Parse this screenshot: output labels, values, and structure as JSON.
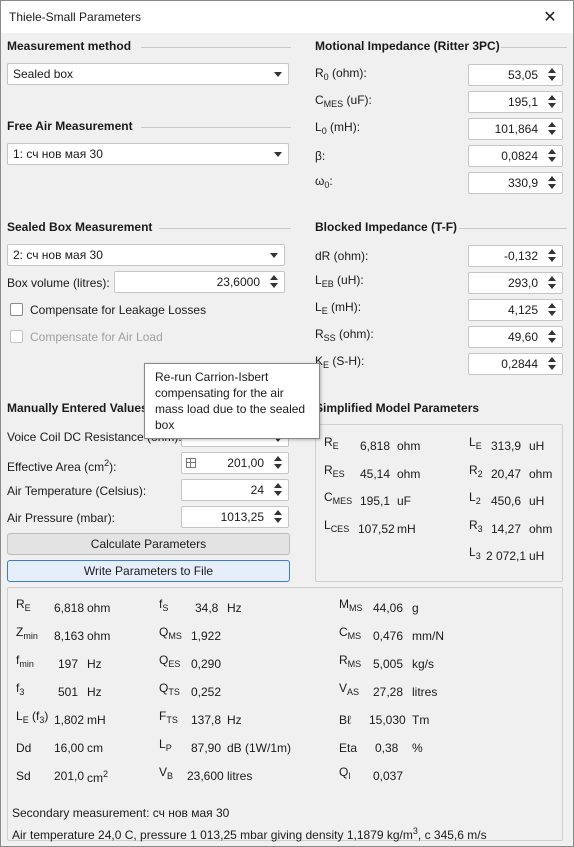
{
  "window": {
    "title": "Thiele-Small Parameters"
  },
  "measurement_method": {
    "heading": "Measurement method",
    "value": "Sealed box"
  },
  "free_air": {
    "heading": "Free Air Measurement",
    "value": "1: сч нов мая 30"
  },
  "sealed_box": {
    "heading": "Sealed Box Measurement",
    "value": "2: сч нов мая 30",
    "volume_label": "Box volume (litres):",
    "volume_value": "23,6000",
    "leakage_label": "Compensate for Leakage Losses",
    "airload_label": "Compensate for Air Load"
  },
  "tooltip": {
    "text": "Re-run Carrion-Isbert compensating for the air mass load due to the sealed box"
  },
  "motional": {
    "heading": "Motional Impedance (Ritter 3PC)",
    "rows": [
      {
        "sym": "R",
        "sub": "0",
        "unit": " (ohm):",
        "value": "53,05"
      },
      {
        "sym": "C",
        "sub": "MES",
        "unit": " (uF):",
        "value": "195,1"
      },
      {
        "sym": "L",
        "sub": "0",
        "unit": " (mH):",
        "value": "101,864"
      },
      {
        "sym": "β:",
        "sub": "",
        "unit": "",
        "value": "0,0824"
      },
      {
        "sym": "ω",
        "sub": "0",
        "unit": ":",
        "value": "330,9"
      }
    ]
  },
  "blocked": {
    "heading": "Blocked Impedance (T-F)",
    "rows": [
      {
        "sym": "dR (ohm):",
        "sub": "",
        "unit": "",
        "value": "-0,132"
      },
      {
        "sym": "L",
        "sub": "EB",
        "unit": " (uH):",
        "value": "293,0"
      },
      {
        "sym": "L",
        "sub": "E",
        "unit": " (mH):",
        "value": "4,125"
      },
      {
        "sym": "R",
        "sub": "SS",
        "unit": " (ohm):",
        "value": "49,60"
      },
      {
        "sym": "K",
        "sub": "E",
        "unit": " (S-H):",
        "value": "0,2844"
      }
    ]
  },
  "manual": {
    "heading": "Manually Entered Values",
    "vc_label": "Voice Coil DC Resistance (ohm):",
    "area_label": "Effective Area (cm",
    "area_sup": "2",
    "area_tail": "):",
    "area_value": "201,00",
    "temp_label": "Air Temperature (Celsius):",
    "temp_value": "24",
    "pressure_label": "Air Pressure (mbar):",
    "pressure_value": "1013,25",
    "calc_button": "Calculate Parameters",
    "write_button": "Write Parameters to File"
  },
  "simplified": {
    "heading": "Simplified Model Parameters",
    "left": [
      {
        "sym": "R",
        "sub": "E",
        "value": "6,818",
        "unit": "ohm"
      },
      {
        "sym": "R",
        "sub": "ES",
        "value": "45,14",
        "unit": "ohm"
      },
      {
        "sym": "C",
        "sub": "MES",
        "value": "195,1",
        "unit": "uF"
      },
      {
        "sym": "L",
        "sub": "CES",
        "value": "107,52",
        "unit": "mH"
      }
    ],
    "right": [
      {
        "sym": "L",
        "sub": "E",
        "value": "313,9",
        "unit": "uH"
      },
      {
        "sym": "R",
        "sub": "2",
        "value": "20,47",
        "unit": "ohm"
      },
      {
        "sym": "L",
        "sub": "2",
        "value": "450,6",
        "unit": "uH"
      },
      {
        "sym": "R",
        "sub": "3",
        "value": "14,27",
        "unit": "ohm"
      },
      {
        "sym": "L",
        "sub": "3",
        "value": "2 072,1",
        "unit": "uH"
      }
    ]
  },
  "results": {
    "col1": [
      {
        "sym": "R",
        "sub": "E",
        "value": "6,818",
        "unit": "ohm"
      },
      {
        "sym": "Z",
        "sub": "min",
        "value": "8,163",
        "unit": "ohm"
      },
      {
        "sym": "f",
        "sub": "min",
        "value": "197",
        "unit": "Hz"
      },
      {
        "sym": "f",
        "sub": "3",
        "value": "501",
        "unit": "Hz"
      },
      {
        "sym": "L",
        "sub": "E",
        "tail": " (f",
        "tailsub": "3",
        "tailend": ")",
        "value": "1,802",
        "unit": "mH"
      },
      {
        "sym": "Dd",
        "sub": "",
        "value": "16,00",
        "unit": "cm"
      },
      {
        "sym": "Sd",
        "sub": "",
        "value": "201,0",
        "unit": "cm",
        "unitsup": "2"
      }
    ],
    "col2": [
      {
        "sym": "f",
        "sub": "S",
        "value": "34,8",
        "unit": "Hz"
      },
      {
        "sym": "Q",
        "sub": "MS",
        "value": "1,922",
        "unit": ""
      },
      {
        "sym": "Q",
        "sub": "ES",
        "value": "0,290",
        "unit": ""
      },
      {
        "sym": "Q",
        "sub": "TS",
        "value": "0,252",
        "unit": ""
      },
      {
        "sym": "F",
        "sub": "TS",
        "value": "137,8",
        "unit": "Hz"
      },
      {
        "sym": "L",
        "sub": "P",
        "value": "87,90",
        "unit": "dB (1W/1m)"
      },
      {
        "sym": "V",
        "sub": "B",
        "value": "23,600",
        "unit": "litres"
      }
    ],
    "col3": [
      {
        "sym": "M",
        "sub": "MS",
        "value": "44,06",
        "unit": "g"
      },
      {
        "sym": "C",
        "sub": "MS",
        "value": "0,476",
        "unit": "mm/N"
      },
      {
        "sym": "R",
        "sub": "MS",
        "value": "5,005",
        "unit": "kg/s"
      },
      {
        "sym": "V",
        "sub": "AS",
        "value": "27,28",
        "unit": "litres"
      },
      {
        "sym": "Bℓ",
        "sub": "",
        "value": "15,030",
        "unit": "Tm"
      },
      {
        "sym": "Eta",
        "sub": "",
        "value": "0,38",
        "unit": "%"
      },
      {
        "sym": "Q",
        "sub": "l",
        "value": "0,037",
        "unit": ""
      }
    ],
    "secondary": "Secondary measurement: сч нов мая 30",
    "air_prefix": "Air temperature 24,0 C, pressure 1 013,25 mbar giving density 1,1879 kg/m",
    "air_sup": "3",
    "air_suffix": ", c 345,6 m/s"
  }
}
